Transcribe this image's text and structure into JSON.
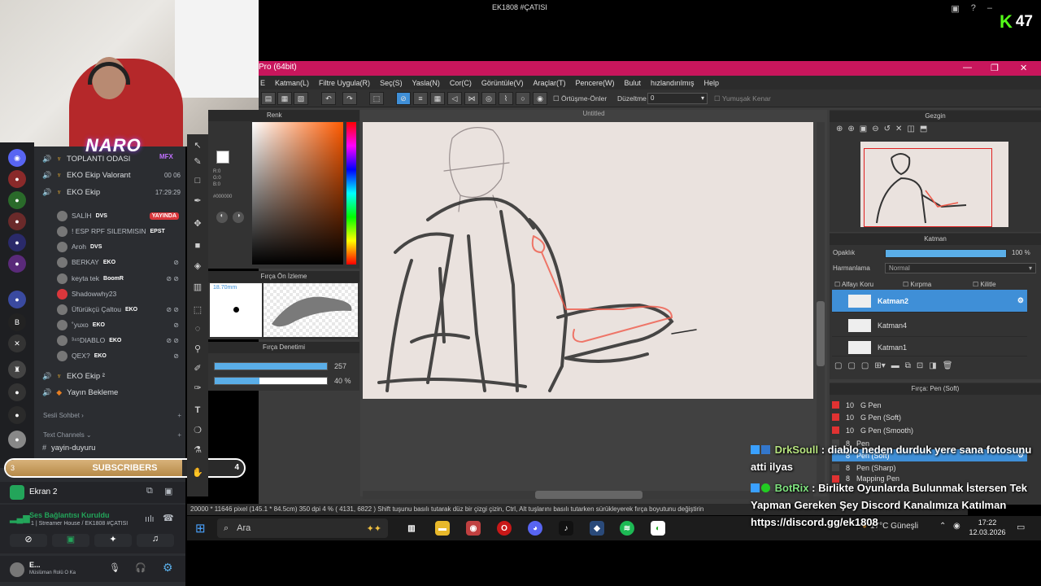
{
  "stream": {
    "title": "EK1808 #ÇATISI",
    "viewers": "47",
    "platform_logo": "K"
  },
  "overlay_logo": {
    "text": "NARO",
    "sub": "MFX"
  },
  "discord": {
    "channels": [
      {
        "name": "TOPLANTI ODASI",
        "right": ""
      },
      {
        "name": "EKO Ekip Valorant",
        "right": "00 06"
      },
      {
        "name": "EKO Ekip",
        "right": "17:29:29"
      }
    ],
    "users": [
      {
        "name": "SALİH",
        "tag": "DVS",
        "badge": "YAYINDA"
      },
      {
        "name": "! ESP RPF SILERMISIN",
        "tag": "EPST",
        "badge": ""
      },
      {
        "name": "Aroh",
        "tag": "DVS",
        "badge": ""
      },
      {
        "name": "BERKAY",
        "tag": "EKO",
        "badge": ""
      },
      {
        "name": "keyta tek",
        "tag": "BoomR",
        "badge": ""
      },
      {
        "name": "Shadowwhy23",
        "tag": "",
        "badge": ""
      },
      {
        "name": "Üfürükçü Çaltou",
        "tag": "EKO",
        "badge": ""
      },
      {
        "name": "˚yuxo",
        "tag": "EKO",
        "badge": ""
      },
      {
        "name": "³⁴⁵DIABLO",
        "tag": "EKO",
        "badge": ""
      },
      {
        "name": "QEX?",
        "tag": "EKO",
        "badge": ""
      }
    ],
    "channels2": [
      {
        "name": "EKO Ekip ²"
      },
      {
        "name": "Yayın Bekleme"
      }
    ],
    "sesli_sohbet": "Sesli Sohbet ›",
    "text_channels": "Text Channels ⌄",
    "yayin_duyuru": "yayin-duyuru",
    "subscribers": {
      "label": "SUBSCRIBERS",
      "current": "3",
      "goal": "4",
      "progress": 0.74
    },
    "ekran": "Ekran 2",
    "voice_status": "Ses Bağlantısı Kuruldu",
    "voice_sub": "1 | Streamer House / EK1808 #ÇATISI",
    "user_name": "E...",
    "user_status": "Müslüman Rolü O Ka"
  },
  "app": {
    "title": "Pro (64bit)",
    "menu": [
      "E",
      "Katman(L)",
      "Filtre Uygula(R)",
      "Seç(S)",
      "Yasla(N)",
      "Cor(C)",
      "Görüntüle(V)",
      "Araçlar(T)",
      "Pencere(W)",
      "Bulut",
      "hızlandırılmış",
      "Help"
    ],
    "toolbar_labels": {
      "overlap": "Örtüşme-Önler",
      "correction": "Düzeltme",
      "correction_value": "0",
      "soft_edge": "Yumuşak Kenar"
    },
    "canvas_title": "Untitled",
    "color_panel": {
      "title": "Renk",
      "rgb": "R:0\nG:0\nB:0",
      "hex": "#000000"
    },
    "brush_preview": {
      "title": "Fırça Ön İzleme",
      "size": "18.70mm"
    },
    "brush_control": {
      "title": "Fırça Denetimi",
      "size_value": "257",
      "opacity_value": "40 %",
      "size_fill": 1.0,
      "opacity_fill": 0.4
    },
    "navigator": {
      "title": "Gezgin"
    },
    "layers": {
      "title": "Katman",
      "opacity_label": "Opaklık",
      "opacity_value": "100 %",
      "blend_label": "Harmanlama",
      "blend_value": "Normal",
      "checks": [
        "Alfayı Koru",
        "Kırpma",
        "Kilitle"
      ],
      "items": [
        {
          "name": "Katman2",
          "selected": true
        },
        {
          "name": "Katman4",
          "selected": false
        },
        {
          "name": "Katman1",
          "selected": false
        }
      ]
    },
    "brushes": {
      "title": "Fırça: Pen (Soft)",
      "items": [
        {
          "size": "10",
          "name": "G Pen"
        },
        {
          "size": "10",
          "name": "G Pen (Soft)"
        },
        {
          "size": "10",
          "name": "G Pen (Smooth)"
        },
        {
          "size": "8",
          "name": "Pen"
        },
        {
          "size": "8",
          "name": "Pen (Soft)"
        },
        {
          "size": "8",
          "name": "Pen (Sharp)"
        },
        {
          "size": "8",
          "name": "Mapping Pen"
        }
      ]
    },
    "status": "20000 * 11646 pixel   (145.1 * 84.5cm)   350 dpi   4 %   ( 4131, 6822 )   Shift tuşunu basılı tutarak düz bir çizgi çizin, Ctrl, Alt tuşlarını basılı tutarken sürükleyerek fırça boyutunu değiştirin"
  },
  "chat": [
    {
      "user": "DrkSoull",
      "text": ": diablo neden durduk yere sana fotosunu atti ilyas"
    },
    {
      "user": "BotRix",
      "text": ": Birlikte Oyunlarda Bulunmak İstersen Tek Yapman Gereken Şey Discord Kanalımıza Katılman https://discord.gg/ek1808"
    }
  ],
  "taskbar": {
    "search": "Ara",
    "weather": "17°C  Güneşli",
    "time": "17:22",
    "date": "12.03.2026"
  }
}
